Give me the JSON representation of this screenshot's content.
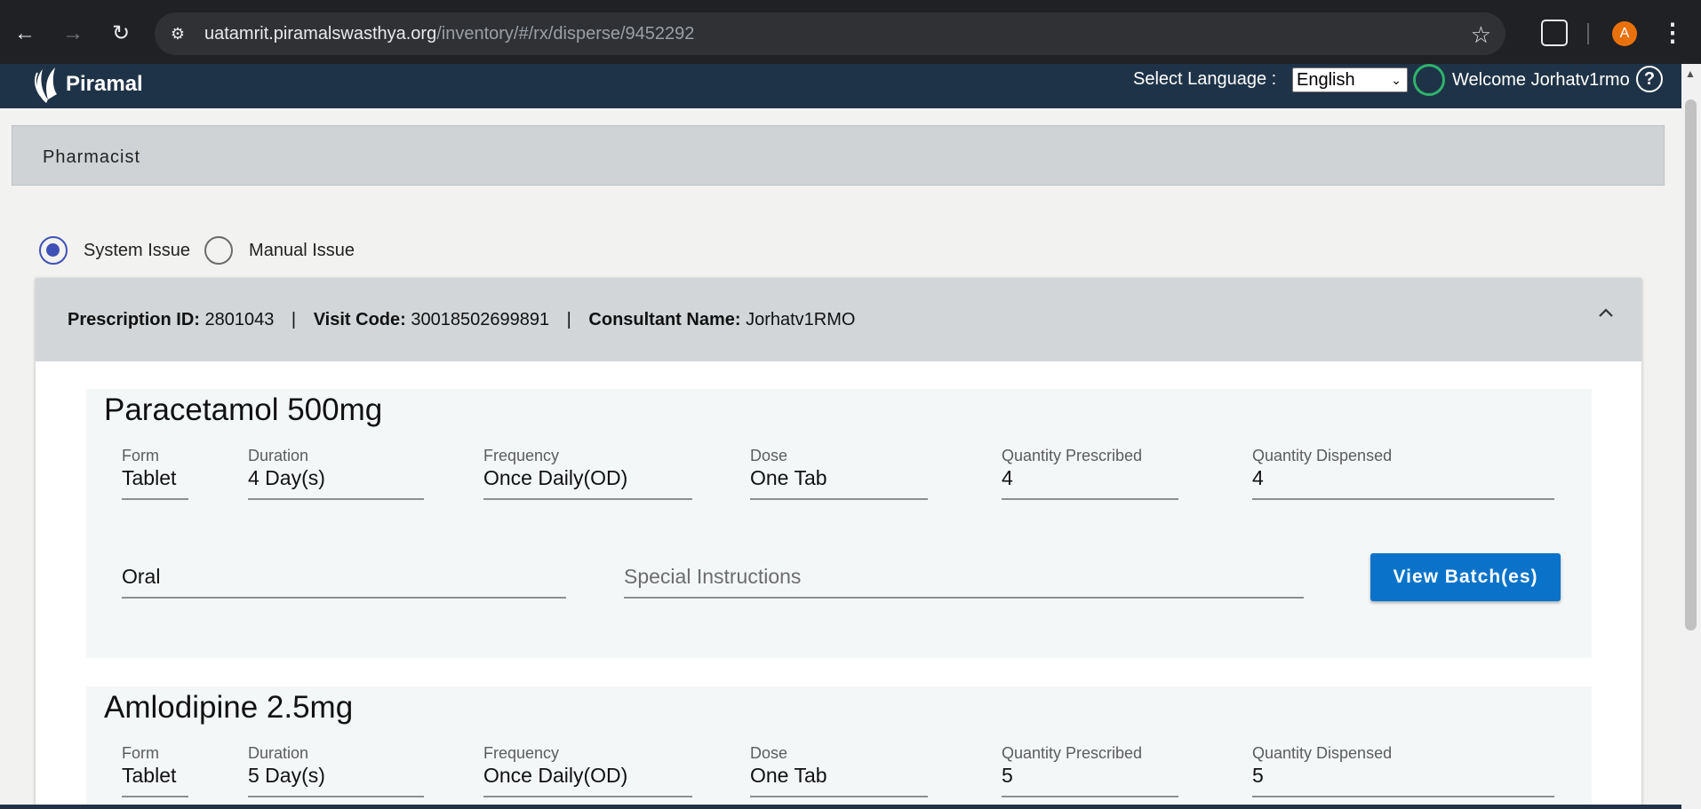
{
  "browser": {
    "url_host": "uatamrit.piramalswasthya.org",
    "url_path": "/inventory/#/rx/disperse/9452292",
    "profile_initial": "A"
  },
  "header": {
    "logo_text": "Piramal",
    "language_label": "Select Language :",
    "language_selected": "English",
    "welcome_prefix": "Welcome",
    "user_name": "Jorhatv1rmo"
  },
  "role_bar": {
    "title": "Pharmacist"
  },
  "issue_type": {
    "options": [
      {
        "label": "System Issue",
        "checked": true
      },
      {
        "label": "Manual Issue",
        "checked": false
      }
    ]
  },
  "prescription": {
    "id_label": "Prescription ID:",
    "id_value": "2801043",
    "visit_label": "Visit Code:",
    "visit_value": "30018502699891",
    "consultant_label": "Consultant Name:",
    "consultant_value": "Jorhatv1RMO",
    "separator": "|"
  },
  "medicines": [
    {
      "name": "Paracetamol 500mg",
      "form_label": "Form",
      "form": "Tablet",
      "duration_label": "Duration",
      "duration": "4 Day(s)",
      "frequency_label": "Frequency",
      "frequency": "Once Daily(OD)",
      "dose_label": "Dose",
      "dose": "One Tab",
      "qty_prescribed_label": "Quantity Prescribed",
      "qty_prescribed": "4",
      "qty_dispensed_label": "Quantity Dispensed",
      "qty_dispensed": "4",
      "route": "Oral",
      "special_instructions_placeholder": "Special Instructions",
      "view_batch_label": "View Batch(es)"
    },
    {
      "name": "Amlodipine 2.5mg",
      "form_label": "Form",
      "form": "Tablet",
      "duration_label": "Duration",
      "duration": "5 Day(s)",
      "frequency_label": "Frequency",
      "frequency": "Once Daily(OD)",
      "dose_label": "Dose",
      "dose": "One Tab",
      "qty_prescribed_label": "Quantity Prescribed",
      "qty_prescribed": "5",
      "qty_dispensed_label": "Quantity Dispensed",
      "qty_dispensed": "5"
    }
  ],
  "colors": {
    "header_bg": "#1f3348",
    "accent_radio": "#3f51b5",
    "button_blue": "#0a73c9",
    "user_icon_green": "#2fb36b"
  },
  "icons": [
    "back-arrow-icon",
    "forward-arrow-icon",
    "reload-icon",
    "site-settings-icon",
    "bookmark-star-icon",
    "extensions-icon",
    "menu-kebab-icon",
    "user-circle-icon",
    "help-icon",
    "chevron-up-icon"
  ]
}
